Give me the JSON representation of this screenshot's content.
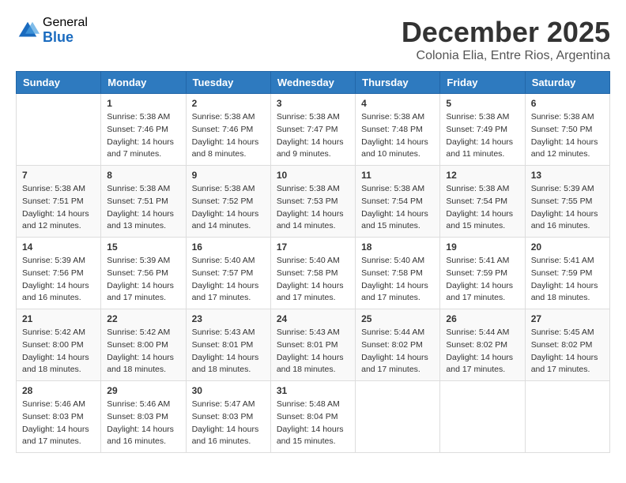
{
  "header": {
    "logo_general": "General",
    "logo_blue": "Blue",
    "month_title": "December 2025",
    "subtitle": "Colonia Elia, Entre Rios, Argentina"
  },
  "calendar": {
    "days_of_week": [
      "Sunday",
      "Monday",
      "Tuesday",
      "Wednesday",
      "Thursday",
      "Friday",
      "Saturday"
    ],
    "weeks": [
      [
        {
          "day": "",
          "info": ""
        },
        {
          "day": "1",
          "info": "Sunrise: 5:38 AM\nSunset: 7:46 PM\nDaylight: 14 hours\nand 7 minutes."
        },
        {
          "day": "2",
          "info": "Sunrise: 5:38 AM\nSunset: 7:46 PM\nDaylight: 14 hours\nand 8 minutes."
        },
        {
          "day": "3",
          "info": "Sunrise: 5:38 AM\nSunset: 7:47 PM\nDaylight: 14 hours\nand 9 minutes."
        },
        {
          "day": "4",
          "info": "Sunrise: 5:38 AM\nSunset: 7:48 PM\nDaylight: 14 hours\nand 10 minutes."
        },
        {
          "day": "5",
          "info": "Sunrise: 5:38 AM\nSunset: 7:49 PM\nDaylight: 14 hours\nand 11 minutes."
        },
        {
          "day": "6",
          "info": "Sunrise: 5:38 AM\nSunset: 7:50 PM\nDaylight: 14 hours\nand 12 minutes."
        }
      ],
      [
        {
          "day": "7",
          "info": "Sunrise: 5:38 AM\nSunset: 7:51 PM\nDaylight: 14 hours\nand 12 minutes."
        },
        {
          "day": "8",
          "info": "Sunrise: 5:38 AM\nSunset: 7:51 PM\nDaylight: 14 hours\nand 13 minutes."
        },
        {
          "day": "9",
          "info": "Sunrise: 5:38 AM\nSunset: 7:52 PM\nDaylight: 14 hours\nand 14 minutes."
        },
        {
          "day": "10",
          "info": "Sunrise: 5:38 AM\nSunset: 7:53 PM\nDaylight: 14 hours\nand 14 minutes."
        },
        {
          "day": "11",
          "info": "Sunrise: 5:38 AM\nSunset: 7:54 PM\nDaylight: 14 hours\nand 15 minutes."
        },
        {
          "day": "12",
          "info": "Sunrise: 5:38 AM\nSunset: 7:54 PM\nDaylight: 14 hours\nand 15 minutes."
        },
        {
          "day": "13",
          "info": "Sunrise: 5:39 AM\nSunset: 7:55 PM\nDaylight: 14 hours\nand 16 minutes."
        }
      ],
      [
        {
          "day": "14",
          "info": "Sunrise: 5:39 AM\nSunset: 7:56 PM\nDaylight: 14 hours\nand 16 minutes."
        },
        {
          "day": "15",
          "info": "Sunrise: 5:39 AM\nSunset: 7:56 PM\nDaylight: 14 hours\nand 17 minutes."
        },
        {
          "day": "16",
          "info": "Sunrise: 5:40 AM\nSunset: 7:57 PM\nDaylight: 14 hours\nand 17 minutes."
        },
        {
          "day": "17",
          "info": "Sunrise: 5:40 AM\nSunset: 7:58 PM\nDaylight: 14 hours\nand 17 minutes."
        },
        {
          "day": "18",
          "info": "Sunrise: 5:40 AM\nSunset: 7:58 PM\nDaylight: 14 hours\nand 17 minutes."
        },
        {
          "day": "19",
          "info": "Sunrise: 5:41 AM\nSunset: 7:59 PM\nDaylight: 14 hours\nand 17 minutes."
        },
        {
          "day": "20",
          "info": "Sunrise: 5:41 AM\nSunset: 7:59 PM\nDaylight: 14 hours\nand 18 minutes."
        }
      ],
      [
        {
          "day": "21",
          "info": "Sunrise: 5:42 AM\nSunset: 8:00 PM\nDaylight: 14 hours\nand 18 minutes."
        },
        {
          "day": "22",
          "info": "Sunrise: 5:42 AM\nSunset: 8:00 PM\nDaylight: 14 hours\nand 18 minutes."
        },
        {
          "day": "23",
          "info": "Sunrise: 5:43 AM\nSunset: 8:01 PM\nDaylight: 14 hours\nand 18 minutes."
        },
        {
          "day": "24",
          "info": "Sunrise: 5:43 AM\nSunset: 8:01 PM\nDaylight: 14 hours\nand 18 minutes."
        },
        {
          "day": "25",
          "info": "Sunrise: 5:44 AM\nSunset: 8:02 PM\nDaylight: 14 hours\nand 17 minutes."
        },
        {
          "day": "26",
          "info": "Sunrise: 5:44 AM\nSunset: 8:02 PM\nDaylight: 14 hours\nand 17 minutes."
        },
        {
          "day": "27",
          "info": "Sunrise: 5:45 AM\nSunset: 8:02 PM\nDaylight: 14 hours\nand 17 minutes."
        }
      ],
      [
        {
          "day": "28",
          "info": "Sunrise: 5:46 AM\nSunset: 8:03 PM\nDaylight: 14 hours\nand 17 minutes."
        },
        {
          "day": "29",
          "info": "Sunrise: 5:46 AM\nSunset: 8:03 PM\nDaylight: 14 hours\nand 16 minutes."
        },
        {
          "day": "30",
          "info": "Sunrise: 5:47 AM\nSunset: 8:03 PM\nDaylight: 14 hours\nand 16 minutes."
        },
        {
          "day": "31",
          "info": "Sunrise: 5:48 AM\nSunset: 8:04 PM\nDaylight: 14 hours\nand 15 minutes."
        },
        {
          "day": "",
          "info": ""
        },
        {
          "day": "",
          "info": ""
        },
        {
          "day": "",
          "info": ""
        }
      ]
    ]
  }
}
